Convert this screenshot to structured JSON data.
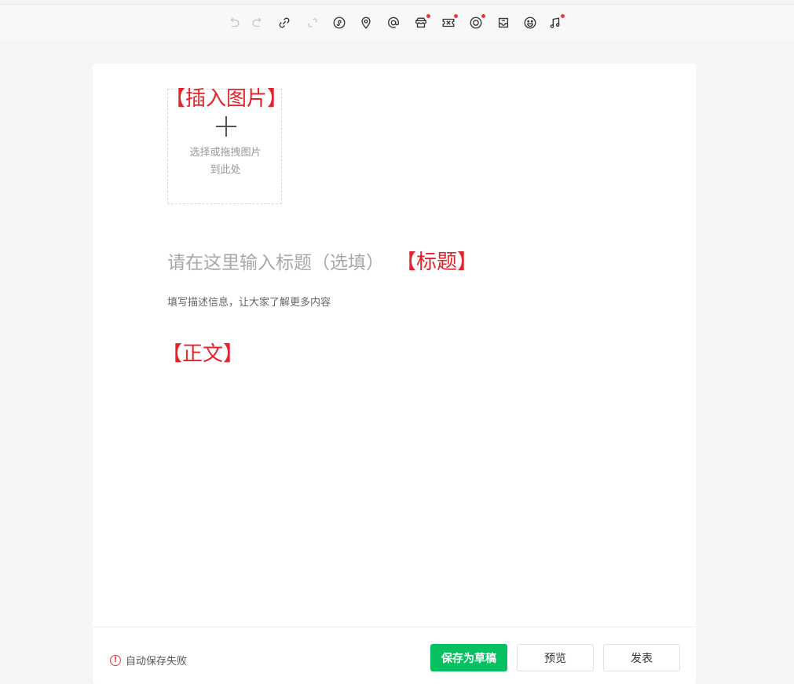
{
  "toolbar": {
    "icons": [
      "undo-icon",
      "redo-icon",
      "link-icon",
      "unlink-icon",
      "mini-program-icon",
      "location-icon",
      "mention-icon",
      "product-icon",
      "coupon-icon",
      "live-icon",
      "box-icon",
      "emoji-icon",
      "music-icon"
    ]
  },
  "editor": {
    "image_upload": {
      "line1": "选择或拖拽图片",
      "line2": "到此处",
      "annotation": "【插入图片】"
    },
    "title": {
      "placeholder": "请在这里输入标题（选填）",
      "annotation": "【标题】"
    },
    "description": {
      "placeholder": "填写描述信息，让大家了解更多内容"
    },
    "body": {
      "annotation": "【正文】"
    }
  },
  "footer": {
    "status_text": "自动保存失败",
    "status_icon": "!",
    "save_draft_label": "保存为草稿",
    "preview_label": "预览",
    "publish_label": "发表"
  },
  "colors": {
    "accent": "#07c160",
    "annotation": "#e5232a",
    "warning": "#e5393a"
  }
}
